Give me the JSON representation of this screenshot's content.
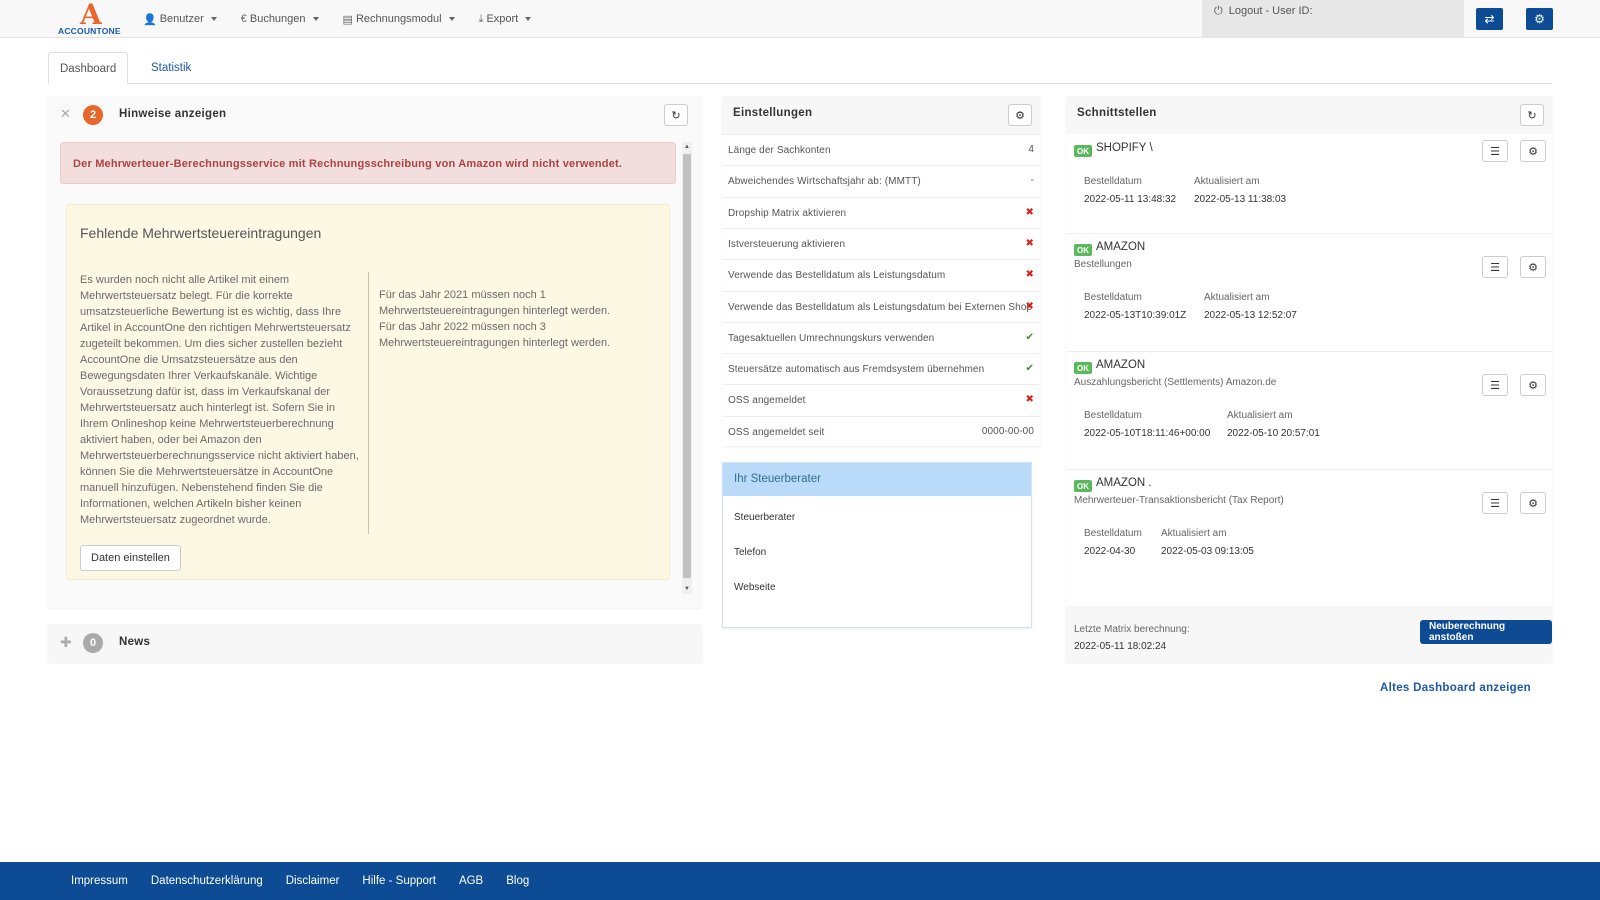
{
  "nav": {
    "logo_text": "ACCOUNTONE",
    "logo_letter": "A",
    "menu": [
      {
        "label": "Benutzer",
        "icon": "user-icon"
      },
      {
        "label": "Buchungen",
        "icon": "euro-icon"
      },
      {
        "label": "Rechnungsmodul",
        "icon": "invoice-icon"
      },
      {
        "label": "Export",
        "icon": "export-icon"
      }
    ],
    "logout_label": "Logout - User ID:",
    "colors": {
      "brand": "#0d4c94",
      "accent": "#e8672c"
    }
  },
  "tabs": [
    {
      "label": "Dashboard",
      "active": true
    },
    {
      "label": "Statistik",
      "active": false
    }
  ],
  "hinweise": {
    "count": "2",
    "title": "Hinweise anzeigen",
    "alert": "Der Mehrwerteuer-Berechnungsservice mit Rechnungsschreibung von Amazon wird nicht verwendet.",
    "box_title": "Fehlende Mehrwertsteuereintragungen",
    "box_left": "Es wurden noch nicht alle Artikel mit einem Mehrwertsteuersatz belegt. Für die korrekte umsatzsteuerliche Bewertung ist es wichtig, dass Ihre Artikel in AccountOne den richtigen Mehrwertsteuersatz zugeteilt bekommen. Um dies sicher zustellen bezieht AccountOne die Umsatzsteuersätze aus den Bewegungsdaten Ihrer Verkaufskanäle. Wichtige Voraussetzung dafür ist, dass im Verkaufskanal der Mehrwertsteuersatz auch hinterlegt ist. Sofern Sie in Ihrem Onlineshop keine Mehrwertsteuerberechnung aktiviert haben, oder bei Amazon den Mehrwertsteuerberechnungsservice nicht aktiviert haben, können Sie die Mehrwertsteuersätze in AccountOne manuell hinzufügen. Nebenstehend finden Sie die Informationen, welchen Artikeln bisher keinen Mehrwertsteuersatz zugeordnet wurde.",
    "box_right_1": "Für das Jahr 2021 müssen noch 1 Mehrwertsteuereintragungen hinterlegt werden.",
    "box_right_2": "Für das Jahr 2022 müssen noch 3 Mehrwertsteuereintragungen hinterlegt werden.",
    "button": "Daten einstellen"
  },
  "news": {
    "count": "0",
    "title": "News"
  },
  "einstellungen": {
    "title": "Einstellungen",
    "rows": [
      {
        "label": "Länge der Sachkonten",
        "value": "4",
        "type": "text"
      },
      {
        "label": "Abweichendes Wirtschaftsjahr ab: (MMTT)",
        "value": "-",
        "type": "text"
      },
      {
        "label": "Dropship Matrix aktivieren",
        "value": "✖",
        "type": "x"
      },
      {
        "label": "Istversteuerung aktivieren",
        "value": "✖",
        "type": "x"
      },
      {
        "label": "Verwende das Bestelldatum als Leistungsdatum",
        "value": "✖",
        "type": "x"
      },
      {
        "label": "Verwende das Bestelldatum als Leistungsdatum bei Externen Shop",
        "value": "✖",
        "type": "x"
      },
      {
        "label": "Tagesaktuellen Umrechnungskurs verwenden",
        "value": "✔",
        "type": "ok"
      },
      {
        "label": "Steuersätze automatisch aus Fremdsystem übernehmen",
        "value": "✔",
        "type": "ok"
      },
      {
        "label": "OSS angemeldet",
        "value": "✖",
        "type": "x"
      },
      {
        "label": "OSS angemeldet seit",
        "value": "0000-00-00",
        "type": "text"
      }
    ]
  },
  "steuerberater": {
    "title": "Ihr Steuerberater",
    "rows": [
      "Steuerberater",
      "Telefon",
      "Webseite"
    ]
  },
  "schnittstellen": {
    "title": "Schnittstellen",
    "ok_label": "OK",
    "label_bestell": "Bestelldatum",
    "label_aktual": "Aktualisiert am",
    "items": [
      {
        "name": "SHOPIFY \\",
        "sub": "",
        "bestelldatum": "2022-05-11 13:48:32",
        "aktualisiert": "2022-05-13 11:38:03"
      },
      {
        "name": "AMAZON",
        "sub": "Bestellungen",
        "bestelldatum": "2022-05-13T10:39:01Z",
        "aktualisiert": "2022-05-13 12:52:07"
      },
      {
        "name": "AMAZON",
        "sub": "Auszahlungsbericht (Settlements) Amazon.de",
        "bestelldatum": "2022-05-10T18:11:46+00:00",
        "aktualisiert": "2022-05-10 20:57:01"
      },
      {
        "name": "AMAZON .",
        "sub": "Mehrwerteuer-Transaktionsbericht (Tax Report)",
        "bestelldatum": "2022-04-30",
        "aktualisiert": "2022-05-03 09:13:05"
      }
    ],
    "matrix_label": "Letzte Matrix berechnung:",
    "matrix_date": "2022-05-11 18:02:24",
    "recalc_button": "Neuberechnung anstoßen"
  },
  "alt_dashboard_link": "Altes Dashboard anzeigen",
  "footer": [
    "Impressum",
    "Datenschutzerklärung",
    "Disclaimer",
    "Hilfe - Support",
    "AGB",
    "Blog"
  ]
}
